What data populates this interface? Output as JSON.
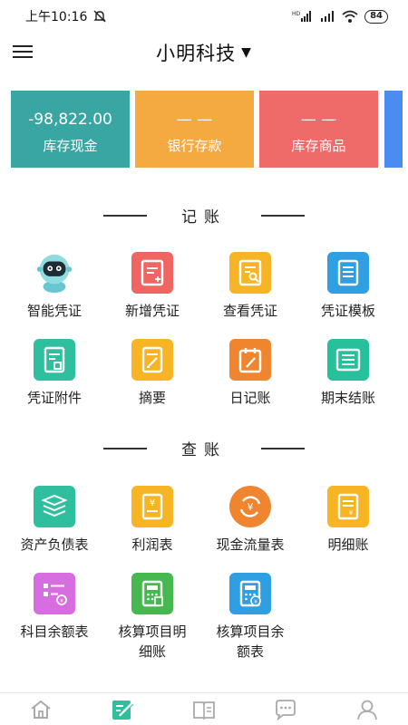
{
  "status_bar": {
    "time": "上午10:16",
    "battery": "84"
  },
  "header": {
    "company": "小明科技",
    "caret": "▼"
  },
  "cards": [
    {
      "value": "-98,822.00",
      "label": "库存现金",
      "color": "#3aa6a3"
    },
    {
      "value": "— —",
      "label": "银行存款",
      "color": "#f5a941"
    },
    {
      "value": "— —",
      "label": "库存商品",
      "color": "#ee6b6a"
    }
  ],
  "sections": {
    "bookkeeping": {
      "title": "记账",
      "items": [
        {
          "label": "智能凭证",
          "icon": "robot-icon"
        },
        {
          "label": "新增凭证",
          "icon": "add-voucher-icon",
          "color": "#ef6562"
        },
        {
          "label": "查看凭证",
          "icon": "view-voucher-icon",
          "color": "#f7b425"
        },
        {
          "label": "凭证模板",
          "icon": "template-icon",
          "color": "#2f9fe2"
        },
        {
          "label": "凭证附件",
          "icon": "attachment-icon",
          "color": "#2fbf9f"
        },
        {
          "label": "摘要",
          "icon": "summary-icon",
          "color": "#f7b425"
        },
        {
          "label": "日记账",
          "icon": "journal-icon",
          "color": "#f0852f"
        },
        {
          "label": "期末结账",
          "icon": "closing-icon",
          "color": "#27c09c"
        }
      ]
    },
    "inquiry": {
      "title": "查账",
      "items": [
        {
          "label": "资产负债表",
          "icon": "balance-sheet-icon",
          "color": "#2fbf9f"
        },
        {
          "label": "利润表",
          "icon": "profit-icon",
          "color": "#f7b425"
        },
        {
          "label": "现金流量表",
          "icon": "cash-flow-icon",
          "color": "#f0852f"
        },
        {
          "label": "明细账",
          "icon": "ledger-icon",
          "color": "#f7b425"
        },
        {
          "label": "科目余额表",
          "icon": "account-balance-icon",
          "color": "#d66ee0"
        },
        {
          "label_line1": "核算项目明",
          "label_line2": "细账",
          "icon": "calculator-icon",
          "color": "#47b84f"
        },
        {
          "label_line1": "核算项目余",
          "label_line2": "额表",
          "icon": "calculator-balance-icon",
          "color": "#2f9fe2"
        }
      ]
    }
  },
  "bottom_nav": [
    {
      "icon": "home-icon"
    },
    {
      "icon": "edit-icon",
      "active": true
    },
    {
      "icon": "book-icon"
    },
    {
      "icon": "chat-icon"
    },
    {
      "icon": "user-icon"
    }
  ],
  "colors": {
    "accent": "#2fbf9f",
    "nav_inactive": "#aaaaaa"
  }
}
